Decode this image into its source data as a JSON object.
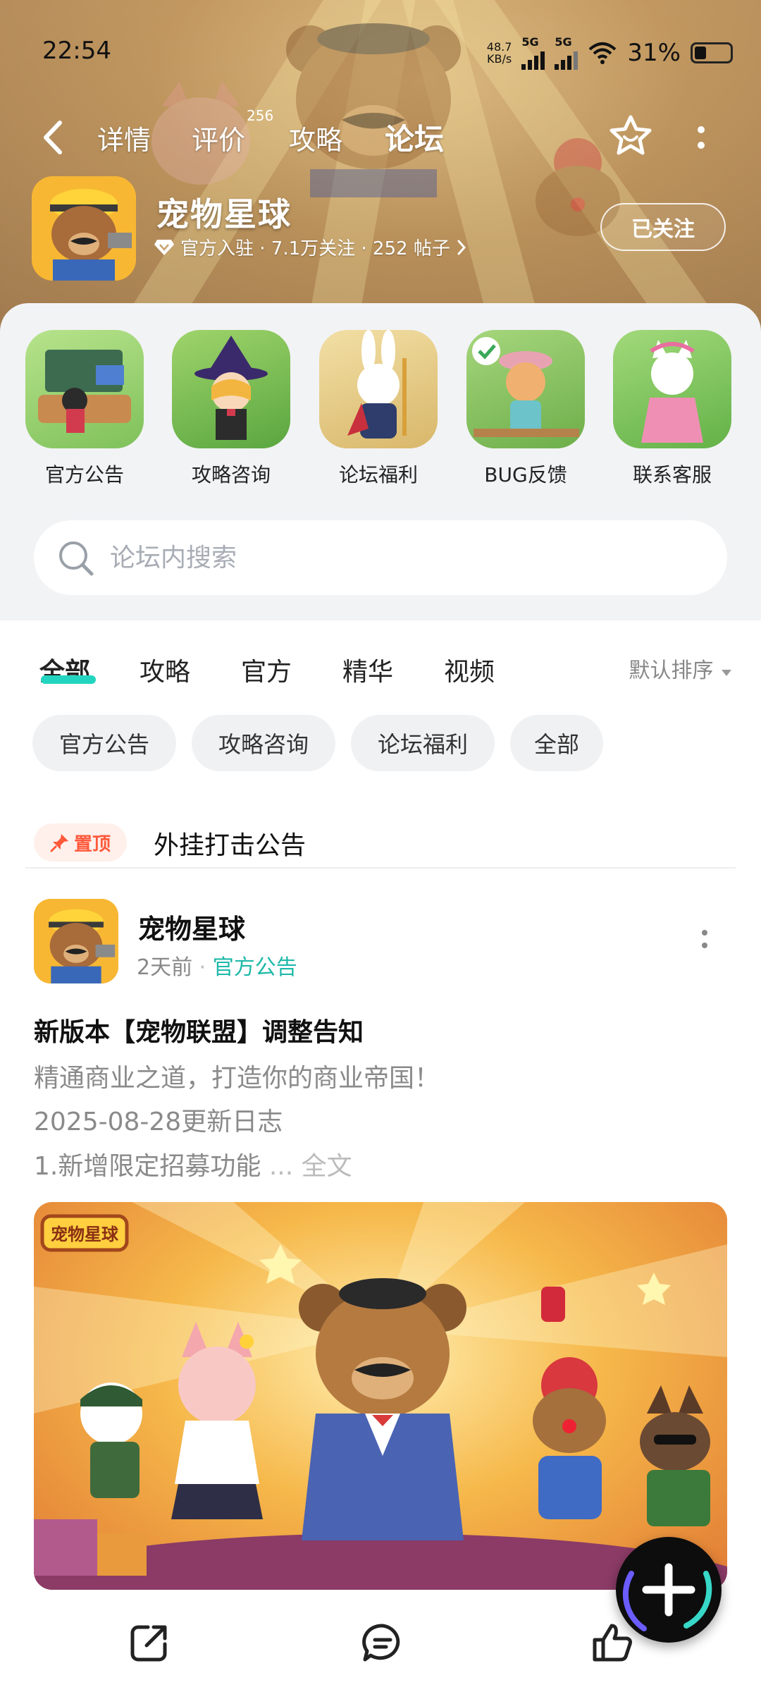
{
  "status_bar": {
    "time": "22:54",
    "net_speed_value": "48.7",
    "net_speed_unit": "KB/s",
    "signal1_label": "5G",
    "signal2_label": "5G",
    "battery": "31%"
  },
  "top_nav": {
    "tabs": [
      {
        "label": "详情"
      },
      {
        "label": "评价",
        "badge": "256"
      },
      {
        "label": "攻略"
      },
      {
        "label": "论坛",
        "active": true
      }
    ]
  },
  "app": {
    "name": "宠物星球",
    "meta": "官方入驻 · 7.1万关注 · 252 帖子",
    "follow_label": "已关注"
  },
  "quick_links": [
    {
      "label": "官方公告"
    },
    {
      "label": "攻略咨询"
    },
    {
      "label": "论坛福利"
    },
    {
      "label": "BUG反馈"
    },
    {
      "label": "联系客服"
    }
  ],
  "search": {
    "placeholder": "论坛内搜索"
  },
  "content_tabs": [
    {
      "label": "全部",
      "active": true
    },
    {
      "label": "攻略"
    },
    {
      "label": "官方"
    },
    {
      "label": "精华"
    },
    {
      "label": "视频"
    }
  ],
  "sort_label": "默认排序",
  "chips": [
    {
      "label": "官方公告"
    },
    {
      "label": "攻略咨询"
    },
    {
      "label": "论坛福利"
    },
    {
      "label": "全部"
    }
  ],
  "pinned": {
    "badge": "置顶",
    "title": "外挂打击公告"
  },
  "post": {
    "author": "宠物星球",
    "time": "2天前",
    "category": "官方公告",
    "title": "新版本【宠物联盟】调整告知",
    "line1": "精通商业之道，打造你的商业帝国！",
    "line2": "2025-08-28更新日志",
    "line3": "1.新增限定招募功能",
    "ellipsis": "...",
    "full_label": "全文",
    "banner_logo": "宠物星球"
  },
  "colors": {
    "accent": "#23d5c0",
    "pin": "#ff5a3c",
    "category": "#1fb9a9"
  }
}
